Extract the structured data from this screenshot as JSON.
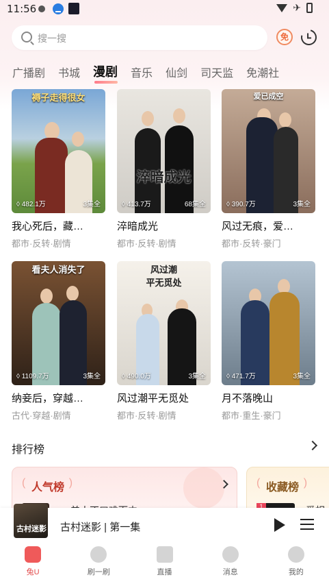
{
  "status": {
    "time": "11:56"
  },
  "search": {
    "placeholder": "搜一搜",
    "free_label": "免"
  },
  "tabs": [
    "广播剧",
    "书城",
    "漫剧",
    "音乐",
    "仙剑",
    "司天监",
    "免潮社"
  ],
  "active_tab": "漫剧",
  "cards": [
    {
      "title": "我心死后，藏…",
      "tags": "都市·反转·剧情",
      "views": "482.1万",
      "episodes": "3集全",
      "poster_text": "褥子走得很女",
      "colors": [
        "#6aa2d4",
        "#7aa34b"
      ]
    },
    {
      "title": "淬暗成光",
      "tags": "都市·反转·剧情",
      "views": "413.7万",
      "episodes": "68集全",
      "poster_text": "淬暗成光",
      "colors": [
        "#dddad5",
        "#b9b6b2"
      ]
    },
    {
      "title": "风过无痕，爱…",
      "tags": "都市·反转·豪门",
      "views": "390.7万",
      "episodes": "3集全",
      "poster_text": "爱已成空",
      "colors": [
        "#b89a86",
        "#6b5548"
      ]
    },
    {
      "title": "纳妾后，穿越…",
      "tags": "古代·穿越·剧情",
      "views": "1109.7万",
      "episodes": "3集全",
      "poster_text": "看夫人消失了",
      "colors": [
        "#6b4a2e",
        "#2c2118"
      ]
    },
    {
      "title": "风过潮平无觅处",
      "tags": "都市·反转·剧情",
      "views": "490.0万",
      "episodes": "3集全",
      "poster_text": "风过潮\n平无觅处",
      "colors": [
        "#f3efe8",
        "#d8d4cc"
      ]
    },
    {
      "title": "月不落晚山",
      "tags": "都市·重生·豪门",
      "views": "471.7万",
      "episodes": "3集全",
      "poster_text": "",
      "colors": [
        "#a9b9c8",
        "#5c6c7a"
      ]
    }
  ],
  "ranking": {
    "header": "排行榜",
    "popular": {
      "title": "人气榜",
      "item": "美人不口难而中"
    },
    "favorites": {
      "title": "收藏榜",
      "item": "爱相",
      "badge": "1"
    }
  },
  "player": {
    "title": "古村迷影 | 第一集",
    "thumb_text": "古村迷影"
  },
  "nav": [
    "兔U",
    "刷一刷",
    "直播",
    "消息",
    "我的"
  ],
  "accent": "#ef5a5a"
}
